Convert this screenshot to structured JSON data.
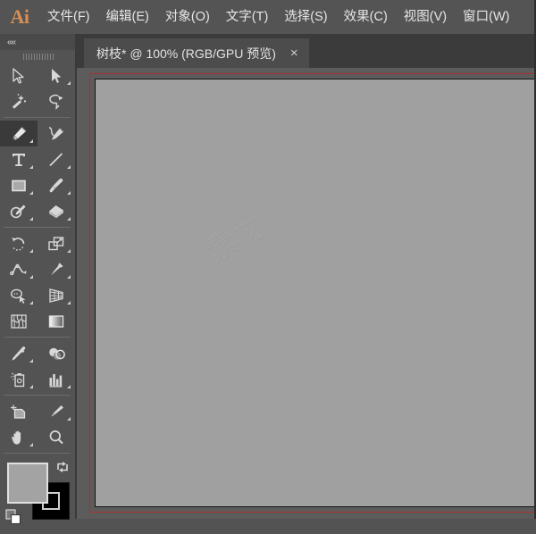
{
  "app": {
    "logo_text": "Ai",
    "name": "Adobe Illustrator"
  },
  "menubar": {
    "items": [
      {
        "label": "文件(F)",
        "name": "menu-file"
      },
      {
        "label": "编辑(E)",
        "name": "menu-edit"
      },
      {
        "label": "对象(O)",
        "name": "menu-object"
      },
      {
        "label": "文字(T)",
        "name": "menu-type"
      },
      {
        "label": "选择(S)",
        "name": "menu-select"
      },
      {
        "label": "效果(C)",
        "name": "menu-effect"
      },
      {
        "label": "视图(V)",
        "name": "menu-view"
      },
      {
        "label": "窗口(W)",
        "name": "menu-window"
      }
    ]
  },
  "tabbar": {
    "tabs": [
      {
        "title": "树枝* @ 100% (RGB/GPU 预览)",
        "close_label": "×",
        "active": true
      }
    ]
  },
  "toolbar": {
    "collapse_label": "««",
    "active_tool": "pen-tool",
    "groups": [
      {
        "tools": [
          {
            "label": "选择工具",
            "icon": "selection-arrow-icon",
            "has_flyout": false
          },
          {
            "label": "直接选择工具",
            "icon": "direct-selection-arrow-icon",
            "has_flyout": true
          },
          {
            "label": "魔棒工具",
            "icon": "magic-wand-icon",
            "has_flyout": false
          },
          {
            "label": "套索工具",
            "icon": "lasso-icon",
            "has_flyout": false
          }
        ]
      },
      {
        "tools": [
          {
            "label": "钢笔工具",
            "icon": "pen-icon",
            "has_flyout": true,
            "active": true
          },
          {
            "label": "曲率工具",
            "icon": "curvature-pen-icon",
            "has_flyout": false
          },
          {
            "label": "文字工具",
            "icon": "type-t-icon",
            "has_flyout": true
          },
          {
            "label": "直线段工具",
            "icon": "line-segment-icon",
            "has_flyout": true
          },
          {
            "label": "矩形工具",
            "icon": "rectangle-icon",
            "has_flyout": true
          },
          {
            "label": "画笔工具",
            "icon": "paintbrush-icon",
            "has_flyout": true
          },
          {
            "label": "Shaper 工具",
            "icon": "shaper-pencil-icon",
            "has_flyout": true
          },
          {
            "label": "橡皮擦工具",
            "icon": "eraser-icon",
            "has_flyout": true
          }
        ]
      },
      {
        "tools": [
          {
            "label": "旋转工具",
            "icon": "rotate-icon",
            "has_flyout": true
          },
          {
            "label": "比例缩放工具",
            "icon": "scale-icon",
            "has_flyout": true
          },
          {
            "label": "宽度工具",
            "icon": "width-icon",
            "has_flyout": true
          },
          {
            "label": "操控变形工具",
            "icon": "puppet-warp-pin-icon",
            "has_flyout": true
          },
          {
            "label": "形状生成器工具",
            "icon": "shape-builder-lasso-icon",
            "has_flyout": true
          },
          {
            "label": "透视网格工具",
            "icon": "perspective-grid-icon",
            "has_flyout": true
          },
          {
            "label": "网格工具",
            "icon": "mesh-icon",
            "has_flyout": false
          },
          {
            "label": "渐变工具",
            "icon": "gradient-square-icon",
            "has_flyout": false
          }
        ]
      },
      {
        "tools": [
          {
            "label": "吸管工具",
            "icon": "eyedropper-icon",
            "has_flyout": true
          },
          {
            "label": "混合工具",
            "icon": "blend-icon",
            "has_flyout": false
          },
          {
            "label": "符号喷枪工具",
            "icon": "symbol-sprayer-icon",
            "has_flyout": true
          },
          {
            "label": "柱形图工具",
            "icon": "column-graph-icon",
            "has_flyout": true
          }
        ]
      },
      {
        "tools": [
          {
            "label": "画板工具",
            "icon": "artboard-icon",
            "has_flyout": false
          },
          {
            "label": "切片工具",
            "icon": "slice-knife-icon",
            "has_flyout": true
          },
          {
            "label": "抓手工具",
            "icon": "hand-icon",
            "has_flyout": true
          },
          {
            "label": "缩放工具",
            "icon": "zoom-magnifier-icon",
            "has_flyout": false
          }
        ]
      }
    ],
    "colors": {
      "fill_label": "填色",
      "fill_color": "#a3a3a3",
      "stroke_label": "描边",
      "stroke_color": "#000000",
      "swap_label": "互换填色和描边",
      "default_label": "默认填色和描边"
    }
  },
  "canvas": {
    "zoom_level": "100%",
    "color_mode": "RGB",
    "preview_mode": "GPU 预览",
    "artboard_fill": "#a0a0a0",
    "bleed_color": "#a8302f",
    "background_color": "#5c5c5c",
    "watermark_text": "素材"
  }
}
